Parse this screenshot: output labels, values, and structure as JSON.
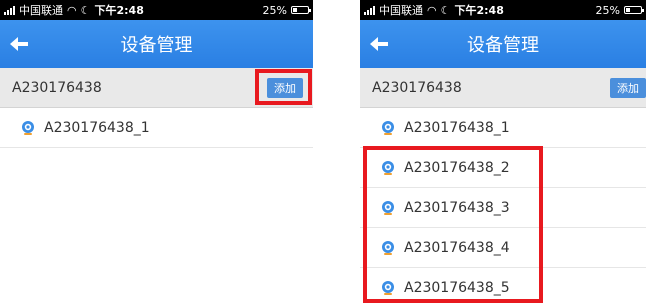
{
  "status_bar": {
    "carrier": "中国联通",
    "time": "下午2:48",
    "battery": "25%"
  },
  "nav": {
    "title": "设备管理"
  },
  "device_header": {
    "name": "A230176438",
    "add_label": "添加"
  },
  "left_screen": {
    "devices": [
      "A230176438_1"
    ]
  },
  "right_screen": {
    "devices": [
      "A230176438_1",
      "A230176438_2",
      "A230176438_3",
      "A230176438_4",
      "A230176438_5"
    ]
  },
  "colors": {
    "nav_blue": "#2a7fe3",
    "highlight_red": "#e8191f",
    "add_button_blue": "#4b8fdc"
  },
  "icons": {
    "back": "back-arrow-icon",
    "device": "camera-icon"
  }
}
